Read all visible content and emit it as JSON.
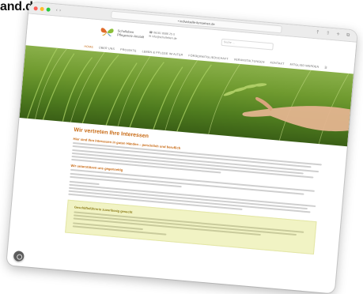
{
  "corner_text": "and.de",
  "browser": {
    "url": "• individuelle-fernsehen.de",
    "nav_buttons": "‹ ›",
    "toolbar_icons": "↑ ⇧ + ⧉"
  },
  "site": {
    "logo_text_line1": "Schulleben",
    "logo_text_line2": "Pflegenetz-Anstalt",
    "contact_line1": "☎ 06181 8086 25 0",
    "contact_line2": "✉ info@schulleben.de",
    "search_placeholder": "Suche ...",
    "menu": [
      {
        "label": "HOME",
        "active": true
      },
      {
        "label": "ÜBER UNS"
      },
      {
        "label": "PROJEKTE"
      },
      {
        "label": "LEBEN & PFLEGE IM ALTER"
      },
      {
        "label": "FÖRDERMITGLIEDSCHAFT"
      },
      {
        "label": "VERANSTALTUNGEN"
      },
      {
        "label": "KONTAKT"
      },
      {
        "label": "MITGLIED WERDEN"
      },
      {
        "label": "☰"
      }
    ],
    "page_heading": "Wir vertreten Ihre Interessen",
    "subheading_1": "Hier sind Ihre Interessen in guten Händen – persönlich und beruflich",
    "subheading_2": "Wir unterstützen uns gegenseitig",
    "note_title": "Geschäftsführerin zuverlässig gesucht",
    "colors": {
      "accent": "#c86a14",
      "note_bg": "#f1f3c4"
    }
  }
}
